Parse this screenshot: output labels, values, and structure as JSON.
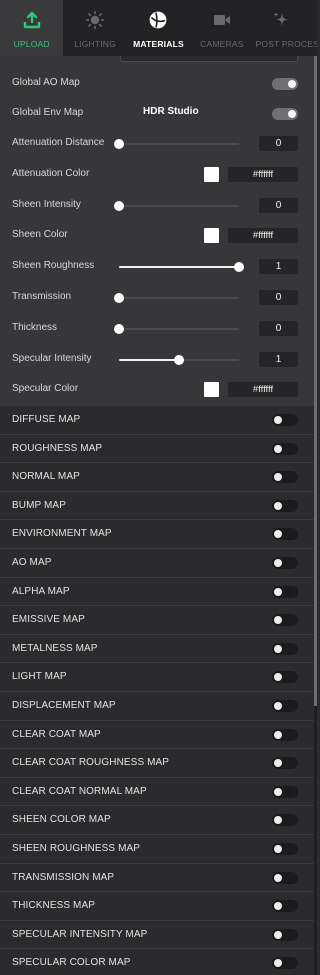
{
  "tabs": [
    {
      "label": "UPLOAD",
      "icon": "upload-icon",
      "state": "active"
    },
    {
      "label": "LIGHTING",
      "icon": "sun-icon",
      "state": "normal"
    },
    {
      "label": "MATERIALS",
      "icon": "materials-icon",
      "state": "selected"
    },
    {
      "label": "CAMERAS",
      "icon": "camera-icon",
      "state": "normal"
    },
    {
      "label": "POST PROCESS",
      "icon": "sparkle-icon",
      "state": "normal"
    }
  ],
  "colors": {
    "accent_green": "#36c77a",
    "panel_bg": "#37373a",
    "list_bg": "#2b2b2d",
    "swatch_white": "#ffffff"
  },
  "properties": [
    {
      "key": "global_ao_map",
      "label": "Global AO Map",
      "type": "toggle",
      "on": true
    },
    {
      "key": "global_env_map",
      "label": "Global Env Map",
      "type": "toggle",
      "on": true,
      "extra": "HDR Studio"
    },
    {
      "key": "attenuation_distance",
      "label": "Attenuation Distance",
      "type": "slider",
      "value": "0",
      "fraction": 0
    },
    {
      "key": "attenuation_color",
      "label": "Attenuation Color",
      "type": "color",
      "hex": "#ffffff"
    },
    {
      "key": "sheen_intensity",
      "label": "Sheen Intensity",
      "type": "slider",
      "value": "0",
      "fraction": 0
    },
    {
      "key": "sheen_color",
      "label": "Sheen Color",
      "type": "color",
      "hex": "#ffffff"
    },
    {
      "key": "sheen_roughness",
      "label": "Sheen Roughness",
      "type": "slider",
      "value": "1",
      "fraction": 1
    },
    {
      "key": "transmission",
      "label": "Transmission",
      "type": "slider",
      "value": "0",
      "fraction": 0
    },
    {
      "key": "thickness",
      "label": "Thickness",
      "type": "slider",
      "value": "0",
      "fraction": 0
    },
    {
      "key": "specular_intensity",
      "label": "Specular Intensity",
      "type": "slider",
      "value": "1",
      "fraction": 0.5
    },
    {
      "key": "specular_color",
      "label": "Specular Color",
      "type": "color",
      "hex": "#ffffff"
    }
  ],
  "maps": [
    "DIFFUSE MAP",
    "ROUGHNESS MAP",
    "NORMAL MAP",
    "BUMP MAP",
    "ENVIRONMENT MAP",
    "AO MAP",
    "ALPHA MAP",
    "EMISSIVE MAP",
    "METALNESS MAP",
    "LIGHT MAP",
    "DISPLACEMENT MAP",
    "CLEAR COAT MAP",
    "CLEAR COAT ROUGHNESS MAP",
    "CLEAR COAT NORMAL MAP",
    "SHEEN COLOR MAP",
    "SHEEN ROUGHNESS MAP",
    "TRANSMISSION MAP",
    "THICKNESS MAP",
    "SPECULAR INTENSITY MAP",
    "SPECULAR COLOR MAP"
  ]
}
